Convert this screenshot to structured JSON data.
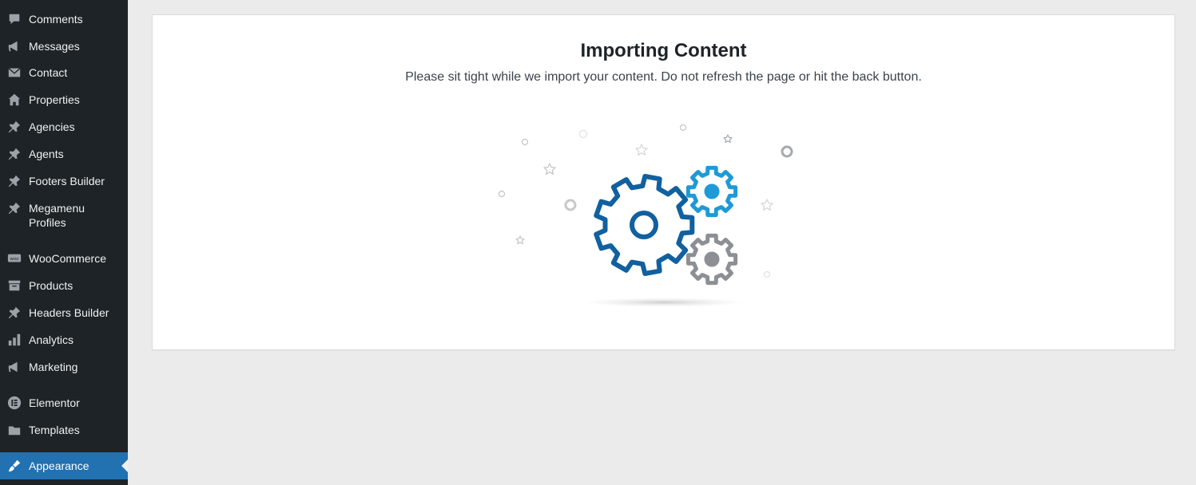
{
  "sidebar": {
    "items": [
      {
        "label": "Comments",
        "icon": "comment-bubble-icon"
      },
      {
        "label": "Messages",
        "icon": "megaphone-icon"
      },
      {
        "label": "Contact",
        "icon": "envelope-icon"
      },
      {
        "label": "Properties",
        "icon": "house-icon"
      },
      {
        "label": "Agencies",
        "icon": "pushpin-icon"
      },
      {
        "label": "Agents",
        "icon": "pushpin-icon"
      },
      {
        "label": "Footers Builder",
        "icon": "pushpin-icon"
      },
      {
        "label": "Megamenu Profiles",
        "icon": "pushpin-icon"
      },
      {
        "label": "WooCommerce",
        "icon": "woocommerce-icon"
      },
      {
        "label": "Products",
        "icon": "archive-box-icon"
      },
      {
        "label": "Headers Builder",
        "icon": "pushpin-icon"
      },
      {
        "label": "Analytics",
        "icon": "bar-chart-icon"
      },
      {
        "label": "Marketing",
        "icon": "megaphone-icon"
      },
      {
        "label": "Elementor",
        "icon": "elementor-icon"
      },
      {
        "label": "Templates",
        "icon": "folder-icon"
      },
      {
        "label": "Appearance",
        "icon": "paintbrush-icon",
        "active": true
      }
    ]
  },
  "main": {
    "title": "Importing Content",
    "subtitle": "Please sit tight while we import your content. Do not refresh the page or hit the back button."
  },
  "colors": {
    "sidebar_bg": "#1d2327",
    "active_bg": "#2271b1",
    "gear_large": "#11609f",
    "gear_blue": "#1e9ad6",
    "gear_gray": "#8c8f94"
  }
}
